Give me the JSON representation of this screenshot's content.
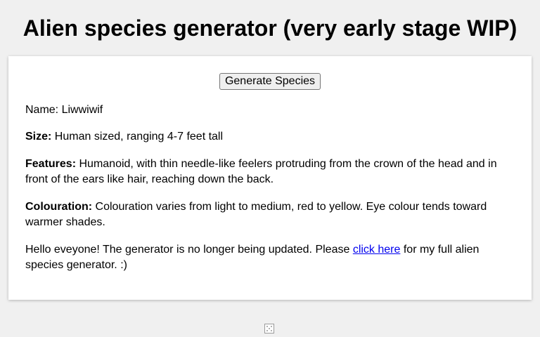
{
  "page": {
    "title": "Alien species generator (very early stage WIP)"
  },
  "generator": {
    "button_label": "Generate Species"
  },
  "species": {
    "name_label": "Name:",
    "name_value": "Liwwiwif",
    "size_label": "Size:",
    "size_value": "Human sized, ranging 4-7 feet tall",
    "features_label": "Features:",
    "features_value": "Humanoid, with thin needle-like feelers protruding from the crown of the head and in front of the ears like hair, reaching down the back.",
    "colouration_label": "Colouration:",
    "colouration_value": "Colouration varies from light to medium, red to yellow. Eye colour tends toward warmer shades."
  },
  "notice": {
    "text_before": "Hello eveyone! The generator is no longer being updated. Please",
    "link_text": "click here",
    "text_after": "for my full alien species generator. :)"
  },
  "footer": {
    "icon": "dice-icon"
  },
  "colors": {
    "background": "#f0f0f0",
    "card": "#ffffff",
    "link": "#0000ee"
  }
}
